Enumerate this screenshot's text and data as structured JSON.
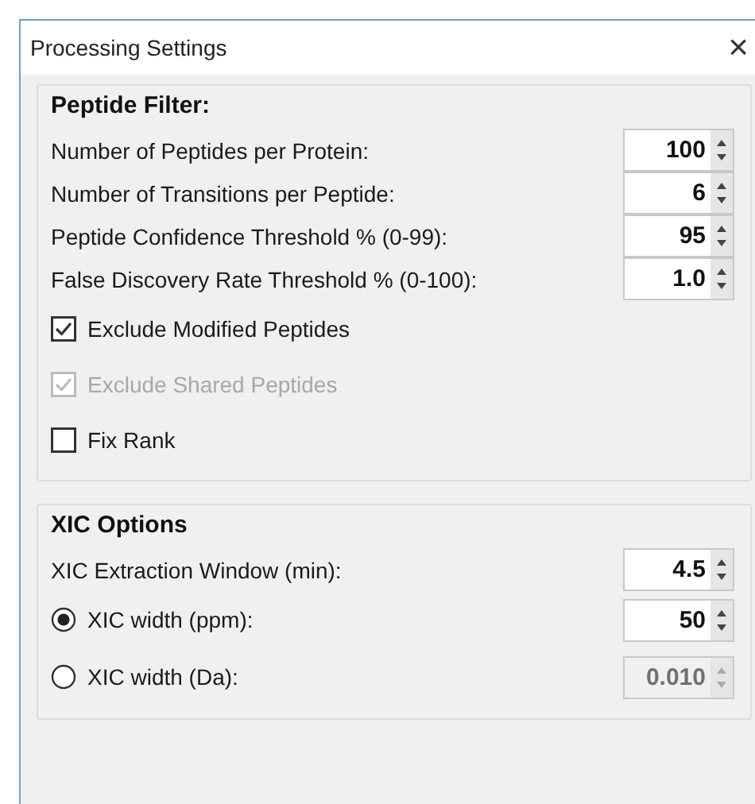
{
  "window": {
    "title": "Processing Settings",
    "close": "×"
  },
  "groups": [
    {
      "title": "Peptide Filter:",
      "items": [
        {
          "kind": "spin",
          "label": "Number of Peptides per Protein:",
          "value": "100",
          "disabled": false
        },
        {
          "kind": "spin",
          "label": "Number of Transitions per Peptide:",
          "value": "6",
          "disabled": false
        },
        {
          "kind": "spin",
          "label": "Peptide Confidence Threshold % (0-99):",
          "value": "95",
          "disabled": false
        },
        {
          "kind": "spin",
          "label": "False Discovery Rate Threshold % (0-100):",
          "value": "1.0",
          "disabled": false
        },
        {
          "kind": "check",
          "label": "Exclude Modified Peptides",
          "checked": true,
          "disabled": false
        },
        {
          "kind": "check",
          "label": "Exclude Shared Peptides",
          "checked": true,
          "disabled": true
        },
        {
          "kind": "check",
          "label": "Fix Rank",
          "checked": false,
          "disabled": false
        }
      ]
    },
    {
      "title": "XIC Options",
      "items": [
        {
          "kind": "spin",
          "label": "XIC Extraction Window (min):",
          "value": "4.5",
          "disabled": false
        },
        {
          "kind": "radio",
          "label": "XIC width (ppm):",
          "value": "50",
          "selected": true,
          "disabled": false
        },
        {
          "kind": "radio",
          "label": "XIC width (Da):",
          "value": "0.010",
          "selected": false,
          "disabled": true
        }
      ]
    }
  ]
}
